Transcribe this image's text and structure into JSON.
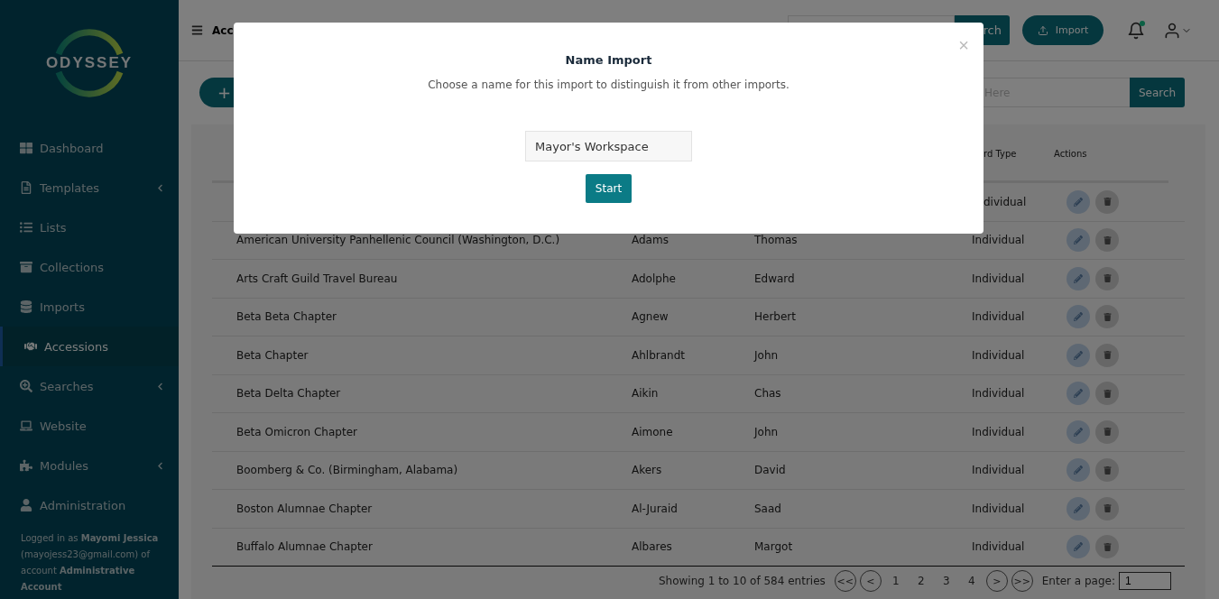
{
  "sidebar": {
    "logo": "ODYSSEY",
    "items": [
      {
        "label": "Dashboard",
        "expandable": false,
        "selected": false
      },
      {
        "label": "Templates",
        "expandable": true,
        "selected": false
      },
      {
        "label": "Lists",
        "expandable": false,
        "selected": false
      },
      {
        "label": "Collections",
        "expandable": false,
        "selected": false
      },
      {
        "label": "Imports",
        "expandable": false,
        "selected": false
      },
      {
        "label": "Accessions",
        "expandable": false,
        "selected": true
      },
      {
        "label": "Searches",
        "expandable": true,
        "selected": false
      },
      {
        "label": "Website",
        "expandable": false,
        "selected": false
      },
      {
        "label": "Modules",
        "expandable": true,
        "selected": false
      },
      {
        "label": "Administration",
        "expandable": false,
        "selected": false
      }
    ],
    "footer": "Logged in as **Mayomi Jessica** (mayojess23@gmail.com) of account **Administrative Account**"
  },
  "header": {
    "title": "Acc",
    "search_button": "rch",
    "import_button": "Import",
    "notifications_unread": true
  },
  "toolbar": {
    "add_button": "+",
    "search": {
      "placeholder": "Here"
    },
    "search_button": "Search"
  },
  "table": {
    "columns": [
      "rd Type",
      "Actions"
    ],
    "rows": [
      {
        "column_4": "dividual"
      },
      {
        "column_1": "American University Panhellenic Council (Washington, D.C.)",
        "column_2": "Adams",
        "column_3": "Thomas",
        "column_4": "Individual"
      },
      {
        "column_1": "Arts Craft Guild Travel Bureau",
        "column_2": "Adolphe",
        "column_3": "Edward",
        "column_4": "Individual"
      },
      {
        "column_1": "Beta Beta Chapter",
        "column_2": "Agnew",
        "column_3": "Herbert",
        "column_4": "Individual"
      },
      {
        "column_1": "Beta Chapter",
        "column_2": "Ahlbrandt",
        "column_3": "John",
        "column_4": "Individual"
      },
      {
        "column_1": "Beta Delta Chapter",
        "column_2": "Aikin",
        "column_3": "Chas",
        "column_4": "Individual"
      },
      {
        "column_1": "Beta Omicron Chapter",
        "column_2": "Aimone",
        "column_3": "John",
        "column_4": "Individual"
      },
      {
        "column_1": "Boomberg & Co. (Birmingham, Alabama)",
        "column_2": "Akers",
        "column_3": "David",
        "column_4": "Individual"
      },
      {
        "column_1": "Boston Alumnae Chapter",
        "column_2": "Al-Juraid",
        "column_3": "Saad",
        "column_4": "Individual"
      },
      {
        "column_1": "Buffalo Alumnae Chapter",
        "column_2": "Albares",
        "column_3": "Margot",
        "column_4": "Individual"
      }
    ]
  },
  "pagination": {
    "summary": "Showing 1 to 10 of 584 entries",
    "first": "<<",
    "prev": "<",
    "pages": [
      "1",
      "2",
      "3",
      "4"
    ],
    "next": ">",
    "last": ">>",
    "page_label": "Enter a page:",
    "page_value": "1"
  },
  "modal": {
    "title": "Name Import",
    "subtitle": "Choose a name for this import to distinguish it from other imports.",
    "close": "×",
    "input_value": "Mayor's Workspace",
    "button": "Start"
  }
}
